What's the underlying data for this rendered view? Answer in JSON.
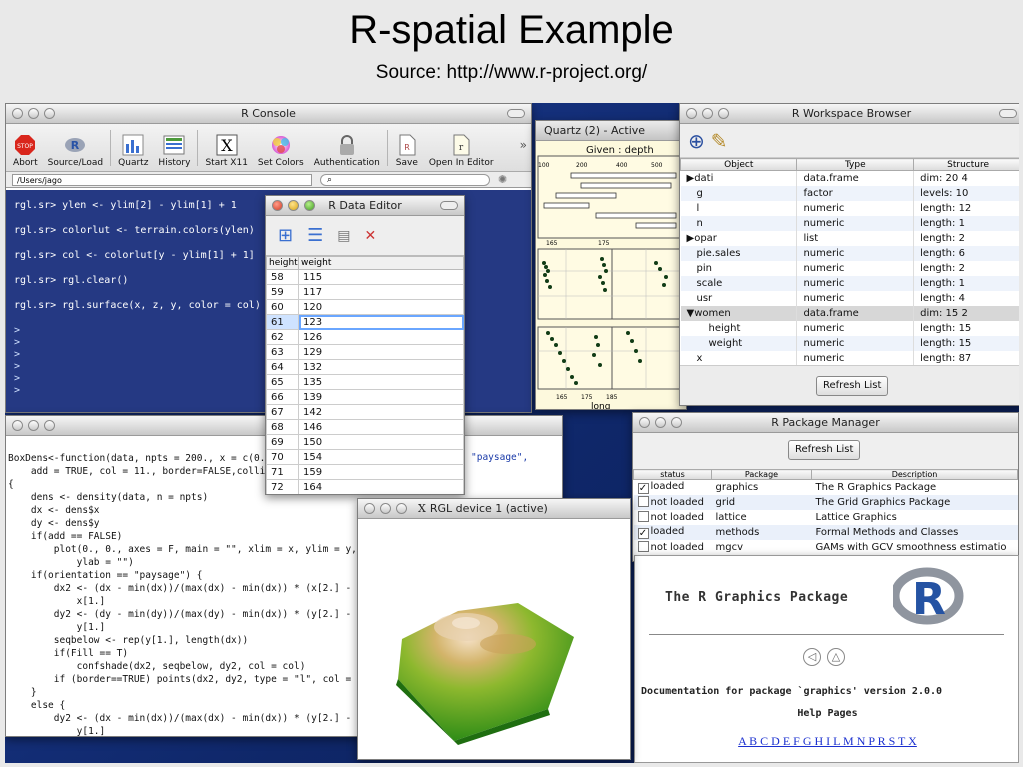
{
  "slide": {
    "title": "R-spatial Example",
    "subtitle": "Source: http://www.r-project.org/"
  },
  "console": {
    "title": "R Console",
    "toolbar": [
      "Abort",
      "Source/Load",
      "Quartz",
      "History",
      "Start X11",
      "Set Colors",
      "Authentication",
      "Save",
      "Open In Editor"
    ],
    "path": "/Users/jago",
    "lines": [
      "rgl.sr> ylen <- ylim[2] - ylim[1] + 1",
      "rgl.sr> colorlut <- terrain.colors(ylen)",
      "rgl.sr> col <- colorlut[y - ylim[1] + 1]",
      "rgl.sr> rgl.clear()",
      "rgl.sr> rgl.surface(x, z, y, color = col)"
    ],
    "prompt": ">"
  },
  "quartz": {
    "title": "Quartz (2) - Active",
    "given": "Given : depth",
    "top_ticks": [
      "100",
      "200",
      "400",
      "500"
    ],
    "mid_ticks": [
      "165",
      "175"
    ],
    "bottom_ticks": [
      "165",
      "175",
      "185"
    ],
    "xlabel": "long"
  },
  "workspace": {
    "title": "R Workspace Browser",
    "headers": [
      "Object",
      "Type",
      "Structure"
    ],
    "rows": [
      {
        "object": "dati",
        "type": "data.frame",
        "structure": "dim: 20 4",
        "arrow": "▶"
      },
      {
        "object": "g",
        "type": "factor",
        "structure": "levels: 10",
        "arrow": ""
      },
      {
        "object": "l",
        "type": "numeric",
        "structure": "length: 12",
        "arrow": ""
      },
      {
        "object": "n",
        "type": "numeric",
        "structure": "length: 1",
        "arrow": ""
      },
      {
        "object": "opar",
        "type": "list",
        "structure": "length: 2",
        "arrow": "▶"
      },
      {
        "object": "pie.sales",
        "type": "numeric",
        "structure": "length: 6",
        "arrow": ""
      },
      {
        "object": "pin",
        "type": "numeric",
        "structure": "length: 2",
        "arrow": ""
      },
      {
        "object": "scale",
        "type": "numeric",
        "structure": "length: 1",
        "arrow": ""
      },
      {
        "object": "usr",
        "type": "numeric",
        "structure": "length: 4",
        "arrow": ""
      },
      {
        "object": "women",
        "type": "data.frame",
        "structure": "dim: 15 2",
        "arrow": "▼"
      },
      {
        "object": "height",
        "type": "numeric",
        "structure": "length: 15",
        "arrow": ""
      },
      {
        "object": "weight",
        "type": "numeric",
        "structure": "length: 15",
        "arrow": ""
      },
      {
        "object": "x",
        "type": "numeric",
        "structure": "length: 87",
        "arrow": ""
      }
    ],
    "refresh": "Refresh List"
  },
  "data_editor": {
    "title": "R Data Editor",
    "headers": [
      "height",
      "weight"
    ],
    "rows": [
      [
        "58",
        "115"
      ],
      [
        "59",
        "117"
      ],
      [
        "60",
        "120"
      ],
      [
        "61",
        "123"
      ],
      [
        "62",
        "126"
      ],
      [
        "63",
        "129"
      ],
      [
        "64",
        "132"
      ],
      [
        "65",
        "135"
      ],
      [
        "66",
        "139"
      ],
      [
        "67",
        "142"
      ],
      [
        "68",
        "146"
      ],
      [
        "69",
        "150"
      ],
      [
        "70",
        "154"
      ],
      [
        "71",
        "159"
      ],
      [
        "72",
        "164"
      ]
    ]
  },
  "code": {
    "lines": [
      "BoxDens<-function(data, npts = 200., x = c(0.,",
      "    add = TRUE, col = 11., border=FALSE,collin",
      "{",
      "    dens <- density(data, n = npts)",
      "    dx <- dens$x",
      "    dy <- dens$y",
      "    if(add == FALSE)",
      "        plot(0., 0., axes = F, main = \"\", xlim = x, ylim = y,",
      "            ylab = \"\")",
      "    if(orientation == \"paysage\") {",
      "        dx2 <- (dx - min(dx))/(max(dx) - min(dx)) * (x[2.] - x[",
      "            x[1.]",
      "        dy2 <- (dy - min(dy))/(max(dy) - min(dx)) * (y[2.] - y[",
      "            y[1.]",
      "        seqbelow <- rep(y[1.], length(dx))",
      "        if(Fill == T)",
      "            confshade(dx2, seqbelow, dy2, col = col)",
      "        if (border==TRUE) points(dx2, dy2, type = \"l\", col = co",
      "    }",
      "    else {",
      "        dy2 <- (dx - min(dx))/(max(dx) - min(dx)) * (y[2.] - y[",
      "            y[1.]"
    ],
    "paysage_tail": "\"paysage\","
  },
  "packages": {
    "title": "R Package Manager",
    "refresh": "Refresh List",
    "headers": [
      "status",
      "Package",
      "Description"
    ],
    "rows": [
      {
        "checked": true,
        "status": "loaded",
        "package": "graphics",
        "description": "The R Graphics Package"
      },
      {
        "checked": false,
        "status": "not loaded",
        "package": "grid",
        "description": "The Grid Graphics Package"
      },
      {
        "checked": false,
        "status": "not loaded",
        "package": "lattice",
        "description": "Lattice Graphics"
      },
      {
        "checked": true,
        "status": "loaded",
        "package": "methods",
        "description": "Formal Methods and Classes"
      },
      {
        "checked": false,
        "status": "not loaded",
        "package": "mgcv",
        "description": "GAMs with GCV smoothness estimatio"
      }
    ]
  },
  "help": {
    "title": "The R Graphics Package",
    "doc": "Documentation for package `graphics' version 2.0.0",
    "help_pages": "Help Pages",
    "letters": "A B C D E F G H I L M N P R S T X"
  },
  "rgl": {
    "title": "RGL device 1 (active)"
  },
  "colors": {
    "desktop": "#14307a",
    "console_bg": "#122878",
    "link": "#1a2fcf",
    "selection": "#6aa6ff"
  }
}
